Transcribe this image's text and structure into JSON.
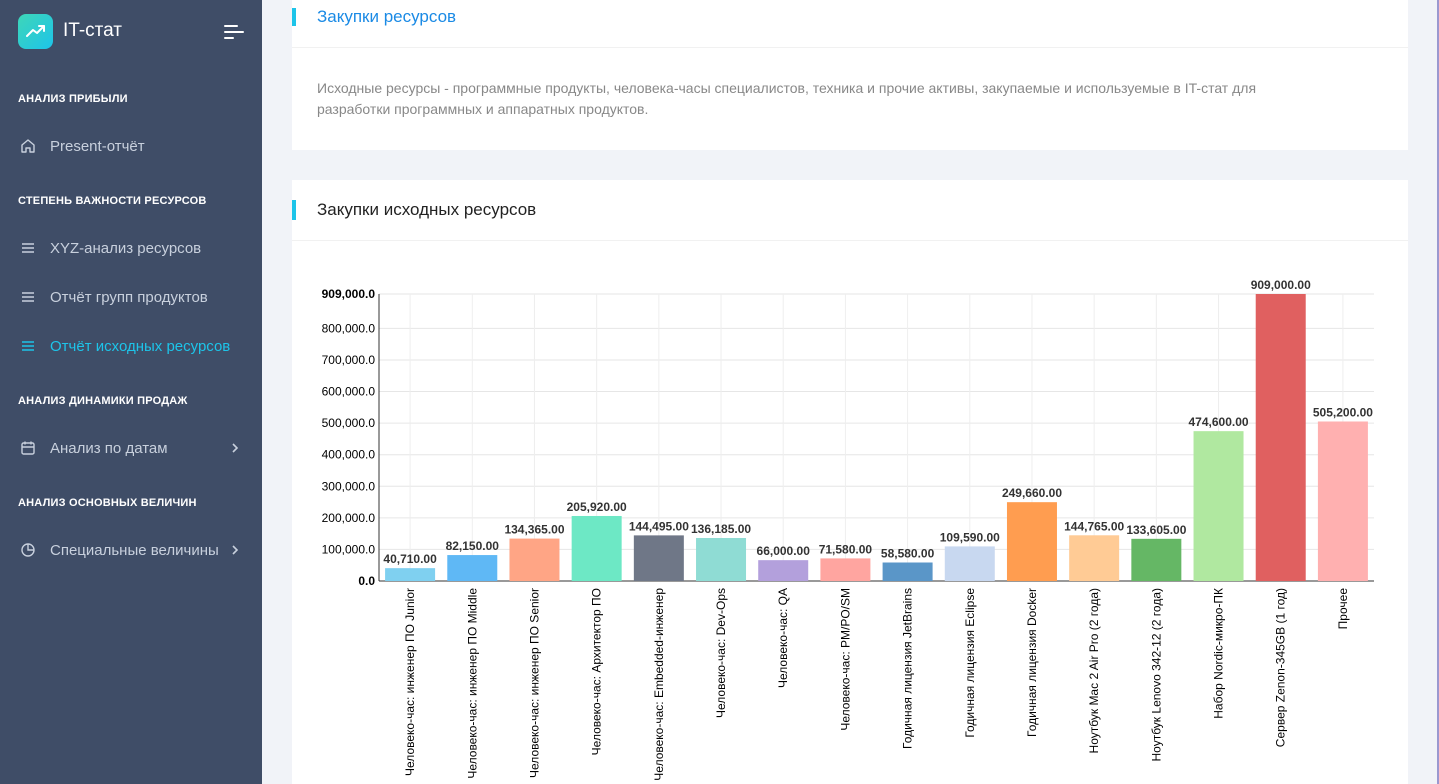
{
  "app": {
    "name": "IT-стат"
  },
  "sidebar": {
    "sections": [
      {
        "title": "АНАЛИЗ ПРИБЫЛИ"
      },
      {
        "title": "СТЕПЕНЬ ВАЖНОСТИ РЕСУРСОВ"
      },
      {
        "title": "АНАЛИЗ ДИНАМИКИ ПРОДАЖ"
      },
      {
        "title": "АНАЛИЗ ОСНОВНЫХ ВЕЛИЧИН"
      }
    ],
    "items": [
      {
        "label": "Present-отчёт",
        "icon": "home-icon"
      },
      {
        "label": "XYZ-анализ ресурсов",
        "icon": "menu-icon"
      },
      {
        "label": "Отчёт групп продуктов",
        "icon": "menu-icon"
      },
      {
        "label": "Отчёт исходных ресурсов",
        "icon": "menu-icon",
        "active": true
      },
      {
        "label": "Анализ по датам",
        "icon": "calendar-icon"
      },
      {
        "label": "Специальные величины",
        "icon": "pie-chart-icon"
      }
    ]
  },
  "colors": {
    "sidebar_bg": "#3f4d67",
    "accent": "#1dc4e9",
    "link_blue": "#1a8ae5"
  },
  "card1": {
    "title": "Закупки ресурсов",
    "description": "Исходные ресурсы - программные продукты, человека-часы специалистов, техника и прочие активы, закупаемые и используемые в IT-стат для разработки программных и аппаратных продуктов."
  },
  "card2": {
    "title": "Закупки исходных ресурсов"
  },
  "chart_data": {
    "type": "bar",
    "categories": [
      "Человеко-час: инженер ПО Junior",
      "Человеко-час: инженер ПО Middle",
      "Человеко-час: инженер ПО Senior",
      "Человеко-час: Архитектор ПО",
      "Человеко-час: Embedded-инженер",
      "Человеко-час: Dev-Ops",
      "Человеко-час: QA",
      "Человеко-час: PM/PO/SM",
      "Годичная лицензия JetBrains",
      "Годичная лицензия Eclipse",
      "Годичная лицензия Docker",
      "Ноутбук Mac 2 Air Pro (2 года)",
      "Ноутбук Lenovo 342-12 (2 года)",
      "Набор Nordic-микро-ПК",
      "Сервер Zenon-345GB (1 год)",
      "Прочее"
    ],
    "values": [
      40710,
      82150,
      134365,
      205920,
      144495,
      136185,
      66000,
      71580,
      58580,
      109590,
      249660,
      144765,
      133605,
      474600,
      909000,
      505200
    ],
    "value_labels": [
      "40,710.00",
      "82,150.00",
      "134,365.00",
      "205,920.00",
      "144,495.00",
      "136,185.00",
      "66,000.00",
      "71,580.00",
      "58,580.00",
      "109,590.00",
      "249,660.00",
      "144,765.00",
      "133,605.00",
      "474,600.00",
      "909,000.00",
      "505,200.00"
    ],
    "colors": [
      "#7fd0f0",
      "#5fb8f5",
      "#ffa585",
      "#6de8c5",
      "#6f7787",
      "#8fdcd4",
      "#b3a0dc",
      "#ffa5a0",
      "#5a96c8",
      "#c8d8f0",
      "#ff9d50",
      "#ffcb95",
      "#65b765",
      "#b0e8a0",
      "#e06060",
      "#ffb0b0"
    ],
    "ylim": [
      0,
      909000
    ],
    "yticks": [
      0,
      100000,
      200000,
      300000,
      400000,
      500000,
      600000,
      700000,
      800000,
      909000
    ],
    "ytick_labels": [
      "0.0",
      "100,000.0",
      "200,000.0",
      "300,000.0",
      "400,000.0",
      "500,000.0",
      "600,000.0",
      "700,000.0",
      "800,000.0",
      "909,000.0"
    ],
    "grid": true,
    "xlabel": "",
    "ylabel": ""
  }
}
